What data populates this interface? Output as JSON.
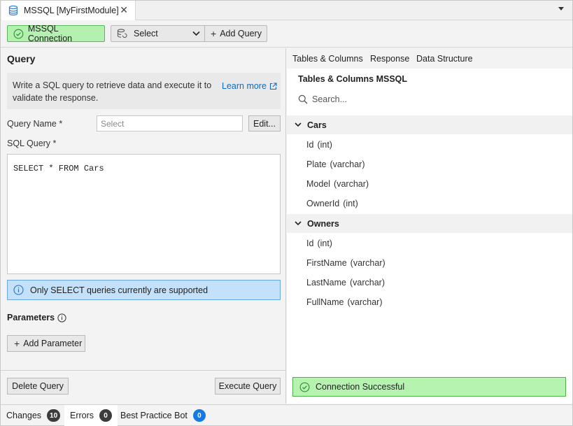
{
  "tab": {
    "label": "MSSQL [MyFirstModule]",
    "close_glyph": "✕"
  },
  "toolbar": {
    "connection_label": "MSSQL Connection",
    "select_value": "Select",
    "add_query_label": "Add Query",
    "colors": {
      "connection_bg": "#b4f0b0",
      "connection_border": "#5ab55a"
    }
  },
  "query": {
    "heading": "Query",
    "description": "Write a SQL query to retrieve data and execute it to validate the response.",
    "learn_more": "Learn more",
    "name_label": "Query Name *",
    "name_placeholder": "Select",
    "edit_label": "Edit...",
    "sql_label": "SQL Query *",
    "sql_text": "SELECT * FROM Cars",
    "notice": "Only SELECT queries currently are supported",
    "parameters_heading": "Parameters",
    "add_parameter_label": "Add Parameter",
    "delete_label": "Delete Query",
    "execute_label": "Execute Query"
  },
  "schema": {
    "tabs": [
      "Tables & Columns",
      "Response",
      "Data Structure"
    ],
    "title": "Tables & Columns MSSQL",
    "search_placeholder": "Search...",
    "tables": [
      {
        "name": "Cars",
        "columns": [
          {
            "name": "Id",
            "type": "(int)"
          },
          {
            "name": "Plate",
            "type": "(varchar)"
          },
          {
            "name": "Model",
            "type": "(varchar)"
          },
          {
            "name": "OwnerId",
            "type": "(int)"
          }
        ]
      },
      {
        "name": "Owners",
        "columns": [
          {
            "name": "Id",
            "type": "(int)"
          },
          {
            "name": "FirstName",
            "type": "(varchar)"
          },
          {
            "name": "LastName",
            "type": "(varchar)"
          },
          {
            "name": "FullName",
            "type": "(varchar)"
          }
        ]
      }
    ],
    "status": "Connection Successful"
  },
  "statusbar": {
    "items": [
      {
        "label": "Changes",
        "count": "10",
        "color": "#3c3c3c"
      },
      {
        "label": "Errors",
        "count": "0",
        "color": "#3c3c3c"
      },
      {
        "label": "Best Practice Bot",
        "count": "0",
        "color": "#1478e6"
      }
    ]
  },
  "icons": {
    "tab": "database-icon",
    "connection": "check-circle-icon",
    "select": "database-refresh-icon",
    "learn_more": "external-link-icon",
    "notice": "info-icon",
    "parameters": "info-icon",
    "search": "search-icon",
    "expand": "chevron-down-icon",
    "status": "check-circle-icon"
  }
}
